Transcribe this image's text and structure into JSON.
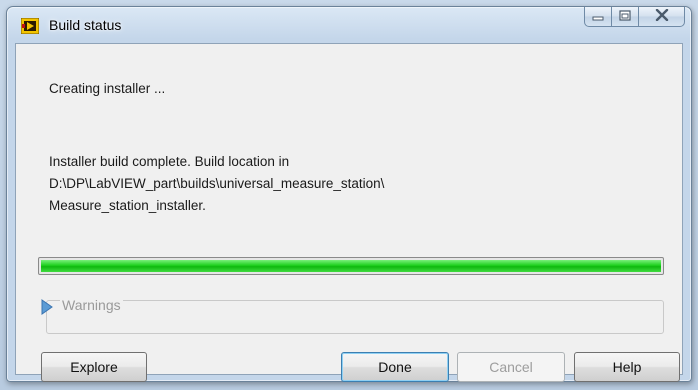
{
  "window": {
    "title": "Build status",
    "controls": {
      "minimize": "minimize",
      "maximize": "maximize",
      "close": "close"
    }
  },
  "status": {
    "line1": "Creating installer ...",
    "message_line1": "Installer build complete. Build location in",
    "message_line2": "D:\\DP\\LabVIEW_part\\builds\\universal_measure_station\\",
    "message_line3": "Measure_station_installer."
  },
  "progress": {
    "percent": 100,
    "color": "#1fd01f"
  },
  "warnings": {
    "label": "Warnings",
    "expanded": false
  },
  "buttons": {
    "explore": "Explore",
    "done": "Done",
    "cancel": "Cancel",
    "help": "Help"
  },
  "icons": {
    "app": "labview-build-icon",
    "minimize": "minimize-icon",
    "maximize": "maximize-icon",
    "close": "close-icon",
    "expand": "triangle-right-icon"
  }
}
